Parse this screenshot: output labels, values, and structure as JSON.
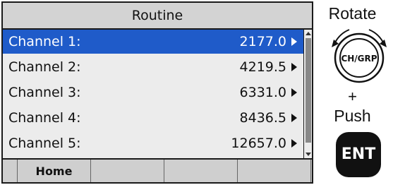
{
  "screen": {
    "title": "Routine",
    "channels": [
      {
        "label": "Channel 1:",
        "value": "2177.0",
        "selected": true
      },
      {
        "label": "Channel 2:",
        "value": "4219.5",
        "selected": false
      },
      {
        "label": "Channel 3:",
        "value": "6331.0",
        "selected": false
      },
      {
        "label": "Channel 4:",
        "value": "8436.5",
        "selected": false
      },
      {
        "label": "Channel 5:",
        "value": "12657.0",
        "selected": false
      }
    ],
    "softkeys": [
      "Home",
      "",
      "",
      ""
    ]
  },
  "instructions": {
    "rotate": "Rotate",
    "dial_label": "CH/GRP",
    "plus": "+",
    "push": "Push",
    "ent_label": "ENT"
  },
  "colors": {
    "selection": "#1f5bc9",
    "screen_bg": "#ececec",
    "title_bg": "#d3d3d3"
  }
}
